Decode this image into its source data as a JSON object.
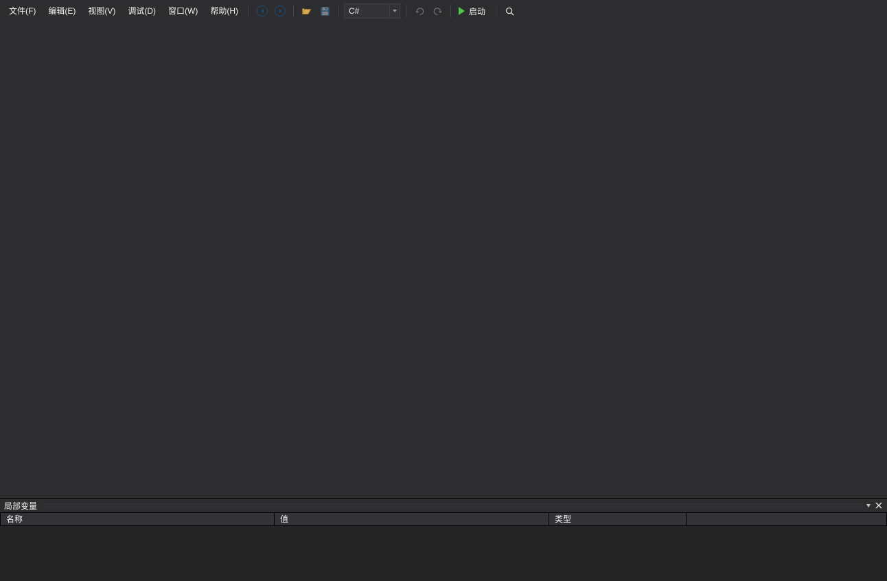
{
  "menus": {
    "file": "文件(F)",
    "edit": "编辑(E)",
    "view": "视图(V)",
    "debug": "调试(D)",
    "window": "窗口(W)",
    "help": "帮助(H)"
  },
  "toolbar": {
    "language_selected": "C#",
    "run_label": "启动"
  },
  "panel": {
    "title": "局部变量",
    "columns": {
      "name": "名称",
      "value": "值",
      "type": "类型"
    }
  }
}
